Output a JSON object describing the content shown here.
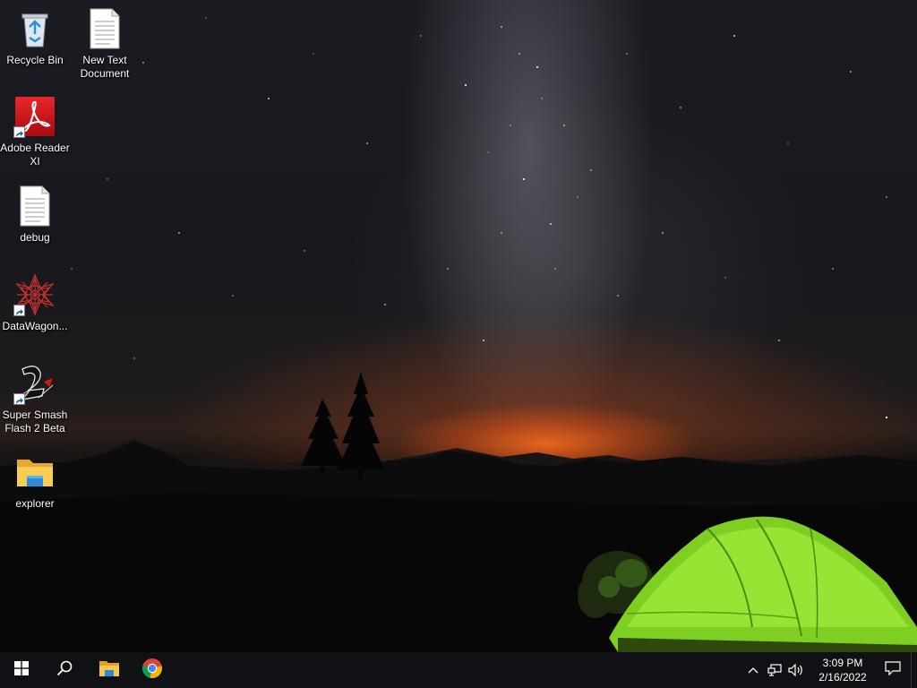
{
  "desktop": {
    "icons": [
      {
        "label": "Recycle Bin",
        "icon": "recycle-bin-icon"
      },
      {
        "label": "New Text Document",
        "icon": "text-document-icon"
      },
      {
        "label": "Adobe Reader XI",
        "icon": "adobe-reader-icon"
      },
      {
        "label": "debug",
        "icon": "text-document-icon"
      },
      {
        "label": "DataWagon...",
        "icon": "datawagon-icon"
      },
      {
        "label": "Super Smash Flash 2 Beta",
        "icon": "super-smash-flash-icon"
      },
      {
        "label": "explorer",
        "icon": "folder-icon"
      }
    ]
  },
  "taskbar": {
    "start": {
      "icon": "windows-logo-icon"
    },
    "search": {
      "icon": "search-icon"
    },
    "pinned": [
      {
        "name": "File Explorer",
        "icon": "file-explorer-icon"
      },
      {
        "name": "Google Chrome",
        "icon": "chrome-icon"
      }
    ],
    "tray": {
      "icons": [
        "chevron-up-icon",
        "network-icon",
        "volume-icon"
      ],
      "time": "3:09 PM",
      "date": "2/16/2022",
      "notification_icon": "notification-icon"
    }
  },
  "colors": {
    "taskbar_bg": "#101114",
    "tent_green": "#8fe028",
    "horizon_orange": "#ff6a1a",
    "adobe_red": "#d9141b",
    "folder_yellow": "#f4c345"
  }
}
